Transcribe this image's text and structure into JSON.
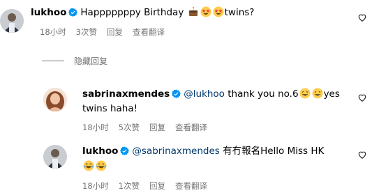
{
  "comments": [
    {
      "username": "lukhoo",
      "text_pre": "Happpppppy Birthday ",
      "text_post": "twins?",
      "emojis": [
        "cake-emoji",
        "star-struck-emoji",
        "star-struck-emoji"
      ],
      "time": "18小时",
      "likes": "3次赞",
      "reply": "回复",
      "translate": "查看翻译"
    },
    {
      "username": "sabrinaxmendes",
      "mention": "@lukhoo",
      "text_line1": " thank you no.6",
      "text_line1_post": "yes",
      "text_line2": "twins haha!",
      "emojis": [
        "grinning-sweat-emoji",
        "grinning-sweat-emoji"
      ],
      "time": "18小时",
      "likes": "5次赞",
      "reply": "回复",
      "translate": "查看翻译"
    },
    {
      "username": "lukhoo",
      "mention": "@sabrinaxmendes",
      "text": " 有冇報名Hello Miss HK",
      "emojis": [
        "joy-emoji",
        "joy-emoji"
      ],
      "time": "18小时",
      "likes": "1次赞",
      "reply": "回复",
      "translate": "查看翻译"
    }
  ],
  "hide_replies_label": "隐藏回复",
  "colors": {
    "meta": "#737373",
    "mention": "#00376b",
    "verified": "#0095f6"
  }
}
